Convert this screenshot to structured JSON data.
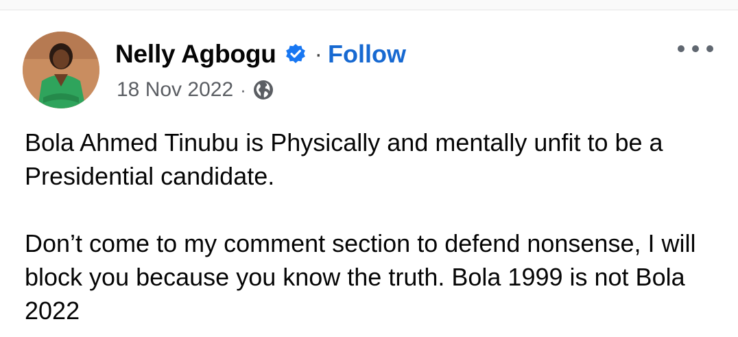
{
  "post": {
    "author": {
      "name": "Nelly Agbogu",
      "verified": true,
      "avatar_icon": "profile-photo"
    },
    "follow_label": "Follow",
    "separator": "·",
    "date": "18 Nov 2022",
    "audience_icon": "globe-icon",
    "more_icon": "more-options-icon",
    "body": {
      "paragraph_1": "Bola Ahmed Tinubu is Physically and mentally unfit to be a Presidential candidate.",
      "paragraph_2": "Don’t come to my comment section to defend nonsense, I will block you because you know the truth. Bola 1999 is not Bola 2022"
    }
  },
  "colors": {
    "follow_link": "#1769d1",
    "verified_badge": "#1877f2",
    "meta_text": "#5b5e63",
    "body_text": "#050505"
  }
}
